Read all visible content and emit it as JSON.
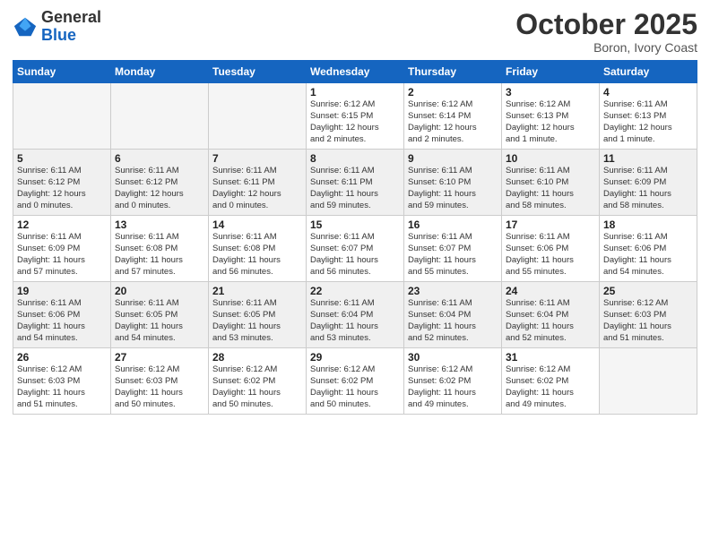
{
  "logo": {
    "general": "General",
    "blue": "Blue"
  },
  "header": {
    "month": "October 2025",
    "location": "Boron, Ivory Coast"
  },
  "weekdays": [
    "Sunday",
    "Monday",
    "Tuesday",
    "Wednesday",
    "Thursday",
    "Friday",
    "Saturday"
  ],
  "weeks": [
    [
      {
        "day": "",
        "info": ""
      },
      {
        "day": "",
        "info": ""
      },
      {
        "day": "",
        "info": ""
      },
      {
        "day": "1",
        "info": "Sunrise: 6:12 AM\nSunset: 6:15 PM\nDaylight: 12 hours\nand 2 minutes."
      },
      {
        "day": "2",
        "info": "Sunrise: 6:12 AM\nSunset: 6:14 PM\nDaylight: 12 hours\nand 2 minutes."
      },
      {
        "day": "3",
        "info": "Sunrise: 6:12 AM\nSunset: 6:13 PM\nDaylight: 12 hours\nand 1 minute."
      },
      {
        "day": "4",
        "info": "Sunrise: 6:11 AM\nSunset: 6:13 PM\nDaylight: 12 hours\nand 1 minute."
      }
    ],
    [
      {
        "day": "5",
        "info": "Sunrise: 6:11 AM\nSunset: 6:12 PM\nDaylight: 12 hours\nand 0 minutes."
      },
      {
        "day": "6",
        "info": "Sunrise: 6:11 AM\nSunset: 6:12 PM\nDaylight: 12 hours\nand 0 minutes."
      },
      {
        "day": "7",
        "info": "Sunrise: 6:11 AM\nSunset: 6:11 PM\nDaylight: 12 hours\nand 0 minutes."
      },
      {
        "day": "8",
        "info": "Sunrise: 6:11 AM\nSunset: 6:11 PM\nDaylight: 11 hours\nand 59 minutes."
      },
      {
        "day": "9",
        "info": "Sunrise: 6:11 AM\nSunset: 6:10 PM\nDaylight: 11 hours\nand 59 minutes."
      },
      {
        "day": "10",
        "info": "Sunrise: 6:11 AM\nSunset: 6:10 PM\nDaylight: 11 hours\nand 58 minutes."
      },
      {
        "day": "11",
        "info": "Sunrise: 6:11 AM\nSunset: 6:09 PM\nDaylight: 11 hours\nand 58 minutes."
      }
    ],
    [
      {
        "day": "12",
        "info": "Sunrise: 6:11 AM\nSunset: 6:09 PM\nDaylight: 11 hours\nand 57 minutes."
      },
      {
        "day": "13",
        "info": "Sunrise: 6:11 AM\nSunset: 6:08 PM\nDaylight: 11 hours\nand 57 minutes."
      },
      {
        "day": "14",
        "info": "Sunrise: 6:11 AM\nSunset: 6:08 PM\nDaylight: 11 hours\nand 56 minutes."
      },
      {
        "day": "15",
        "info": "Sunrise: 6:11 AM\nSunset: 6:07 PM\nDaylight: 11 hours\nand 56 minutes."
      },
      {
        "day": "16",
        "info": "Sunrise: 6:11 AM\nSunset: 6:07 PM\nDaylight: 11 hours\nand 55 minutes."
      },
      {
        "day": "17",
        "info": "Sunrise: 6:11 AM\nSunset: 6:06 PM\nDaylight: 11 hours\nand 55 minutes."
      },
      {
        "day": "18",
        "info": "Sunrise: 6:11 AM\nSunset: 6:06 PM\nDaylight: 11 hours\nand 54 minutes."
      }
    ],
    [
      {
        "day": "19",
        "info": "Sunrise: 6:11 AM\nSunset: 6:06 PM\nDaylight: 11 hours\nand 54 minutes."
      },
      {
        "day": "20",
        "info": "Sunrise: 6:11 AM\nSunset: 6:05 PM\nDaylight: 11 hours\nand 54 minutes."
      },
      {
        "day": "21",
        "info": "Sunrise: 6:11 AM\nSunset: 6:05 PM\nDaylight: 11 hours\nand 53 minutes."
      },
      {
        "day": "22",
        "info": "Sunrise: 6:11 AM\nSunset: 6:04 PM\nDaylight: 11 hours\nand 53 minutes."
      },
      {
        "day": "23",
        "info": "Sunrise: 6:11 AM\nSunset: 6:04 PM\nDaylight: 11 hours\nand 52 minutes."
      },
      {
        "day": "24",
        "info": "Sunrise: 6:11 AM\nSunset: 6:04 PM\nDaylight: 11 hours\nand 52 minutes."
      },
      {
        "day": "25",
        "info": "Sunrise: 6:12 AM\nSunset: 6:03 PM\nDaylight: 11 hours\nand 51 minutes."
      }
    ],
    [
      {
        "day": "26",
        "info": "Sunrise: 6:12 AM\nSunset: 6:03 PM\nDaylight: 11 hours\nand 51 minutes."
      },
      {
        "day": "27",
        "info": "Sunrise: 6:12 AM\nSunset: 6:03 PM\nDaylight: 11 hours\nand 50 minutes."
      },
      {
        "day": "28",
        "info": "Sunrise: 6:12 AM\nSunset: 6:02 PM\nDaylight: 11 hours\nand 50 minutes."
      },
      {
        "day": "29",
        "info": "Sunrise: 6:12 AM\nSunset: 6:02 PM\nDaylight: 11 hours\nand 50 minutes."
      },
      {
        "day": "30",
        "info": "Sunrise: 6:12 AM\nSunset: 6:02 PM\nDaylight: 11 hours\nand 49 minutes."
      },
      {
        "day": "31",
        "info": "Sunrise: 6:12 AM\nSunset: 6:02 PM\nDaylight: 11 hours\nand 49 minutes."
      },
      {
        "day": "",
        "info": ""
      }
    ]
  ]
}
